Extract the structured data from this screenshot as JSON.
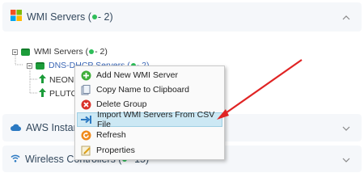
{
  "panels": {
    "wmi": {
      "title": "WMI Servers (",
      "count": "- 2",
      "close_paren": ")"
    },
    "aws": {
      "title": "AWS Instanc"
    },
    "wireless": {
      "title": "Wireless Controllers (",
      "count": "- 15",
      "close_paren": ")"
    }
  },
  "tree": {
    "root": {
      "label": "WMI Servers (",
      "count": "- 2",
      "close_paren": ")"
    },
    "group": {
      "label": "DNS-DHCP Servers (",
      "count": "- 2",
      "close_paren": ")"
    },
    "children": [
      "NEON",
      "PLUTO"
    ]
  },
  "context_menu": {
    "items": [
      {
        "label": "Add New WMI Server",
        "icon": "plus-circle-icon"
      },
      {
        "label": "Copy Name to Clipboard",
        "icon": "clipboard-icon"
      },
      {
        "label": "Delete Group",
        "icon": "delete-icon"
      },
      {
        "label": "Import WMI Servers From CSV File",
        "icon": "import-arrow-icon",
        "highlighted": true
      },
      {
        "label": "Refresh",
        "icon": "refresh-icon"
      },
      {
        "label": "Properties",
        "icon": "properties-icon"
      }
    ]
  },
  "colors": {
    "status_dot": "#2ebd59",
    "annotation_arrow": "#e02424",
    "highlight": "#cce8f4"
  }
}
